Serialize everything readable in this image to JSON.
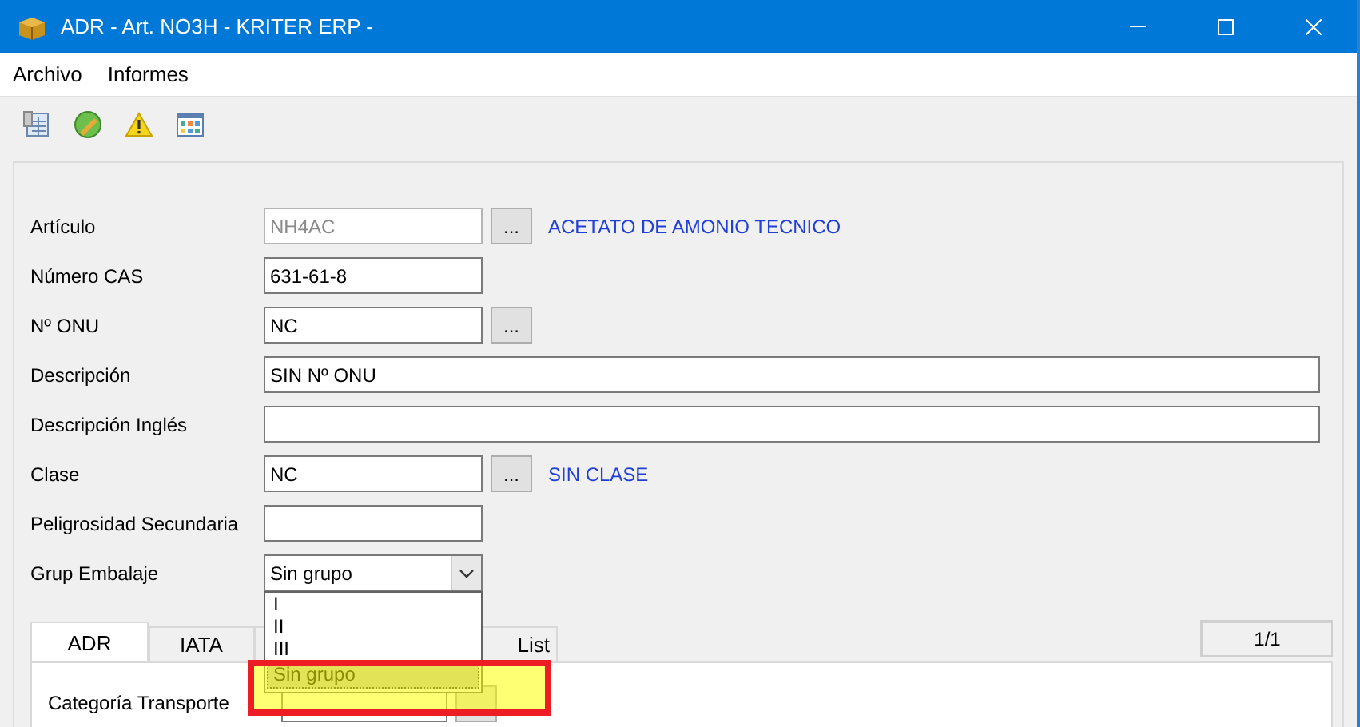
{
  "window": {
    "title": "ADR - Art. NO3H - KRITER ERP -"
  },
  "menu": [
    "Archivo",
    "Informes"
  ],
  "fields": [
    {
      "label": "Artículo",
      "kind": "lookup",
      "value": "NH4AC",
      "disabled": true,
      "button": "...",
      "description": "ACETATO DE AMONIO TECNICO"
    },
    {
      "label": "Número CAS",
      "kind": "short",
      "value": "631-61-8",
      "disabled": false
    },
    {
      "label": "Nº ONU",
      "kind": "lookup",
      "value": "NC",
      "disabled": false,
      "button": "..."
    },
    {
      "label": "Descripción",
      "kind": "wide",
      "value": "SIN Nº ONU",
      "disabled": false
    },
    {
      "label": "Descripción Inglés",
      "kind": "wide",
      "disabled": false
    },
    {
      "label": "Clase",
      "kind": "lookup",
      "value": "NC",
      "disabled": false,
      "button": "...",
      "description": "SIN CLASE"
    },
    {
      "label": "Peligrosidad Secundaria",
      "kind": "short",
      "disabled": false
    },
    {
      "label": "Grup Embalaje",
      "kind": "combo",
      "value": "Sin grupo",
      "expanded": true,
      "options": [
        {
          "label": "I",
          "selected": false
        },
        {
          "label": "II",
          "selected": false
        },
        {
          "label": "III",
          "selected": false
        },
        {
          "label": "Sin grupo",
          "selected": true
        }
      ]
    }
  ],
  "tabs": [
    {
      "label": "ADR",
      "selected": true
    },
    {
      "label": "IATA",
      "selected": false
    },
    {
      "label": "List",
      "selected": false
    }
  ],
  "pager": "1/1",
  "tab_content": {
    "fields": [
      {
        "label": "Categoría Transporte"
      }
    ]
  }
}
